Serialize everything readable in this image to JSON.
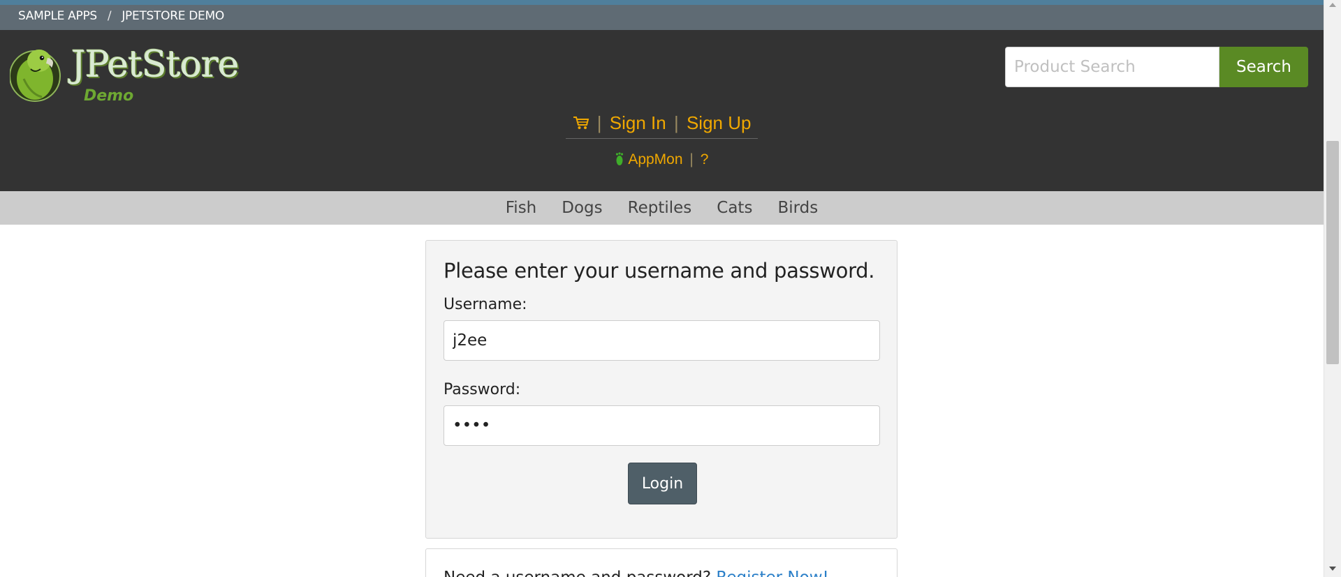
{
  "breadcrumb": {
    "items": [
      "SAMPLE APPS",
      "JPETSTORE DEMO"
    ],
    "separator": "/"
  },
  "header": {
    "logo": {
      "title": "JPetStore",
      "subtitle": "Demo",
      "icon": "parrot-logo-icon"
    },
    "search": {
      "placeholder": "Product Search",
      "value": "",
      "button_label": "Search"
    },
    "account_links": {
      "cart_icon": "cart-icon",
      "separator": "|",
      "sign_in": "Sign In",
      "sign_up": "Sign Up"
    },
    "util_links": {
      "appmon_icon": "footprint-icon",
      "appmon": "AppMon",
      "separator": "|",
      "help": "?"
    }
  },
  "categories": [
    "Fish",
    "Dogs",
    "Reptiles",
    "Cats",
    "Birds"
  ],
  "login": {
    "title": "Please enter your username and password.",
    "username_label": "Username:",
    "username_value": "j2ee",
    "password_label": "Password:",
    "password_value": "••••",
    "button_label": "Login"
  },
  "register": {
    "text": "Need a username and password?",
    "link": "Register Now!"
  },
  "colors": {
    "header_bg": "#333333",
    "breadcrumb_bg": "#5f6b74",
    "accent_link": "#f0a800",
    "search_button": "#5a8a24",
    "nav_bg": "#cccccc",
    "login_button": "#4f5f68",
    "register_link": "#2a7fc8"
  }
}
